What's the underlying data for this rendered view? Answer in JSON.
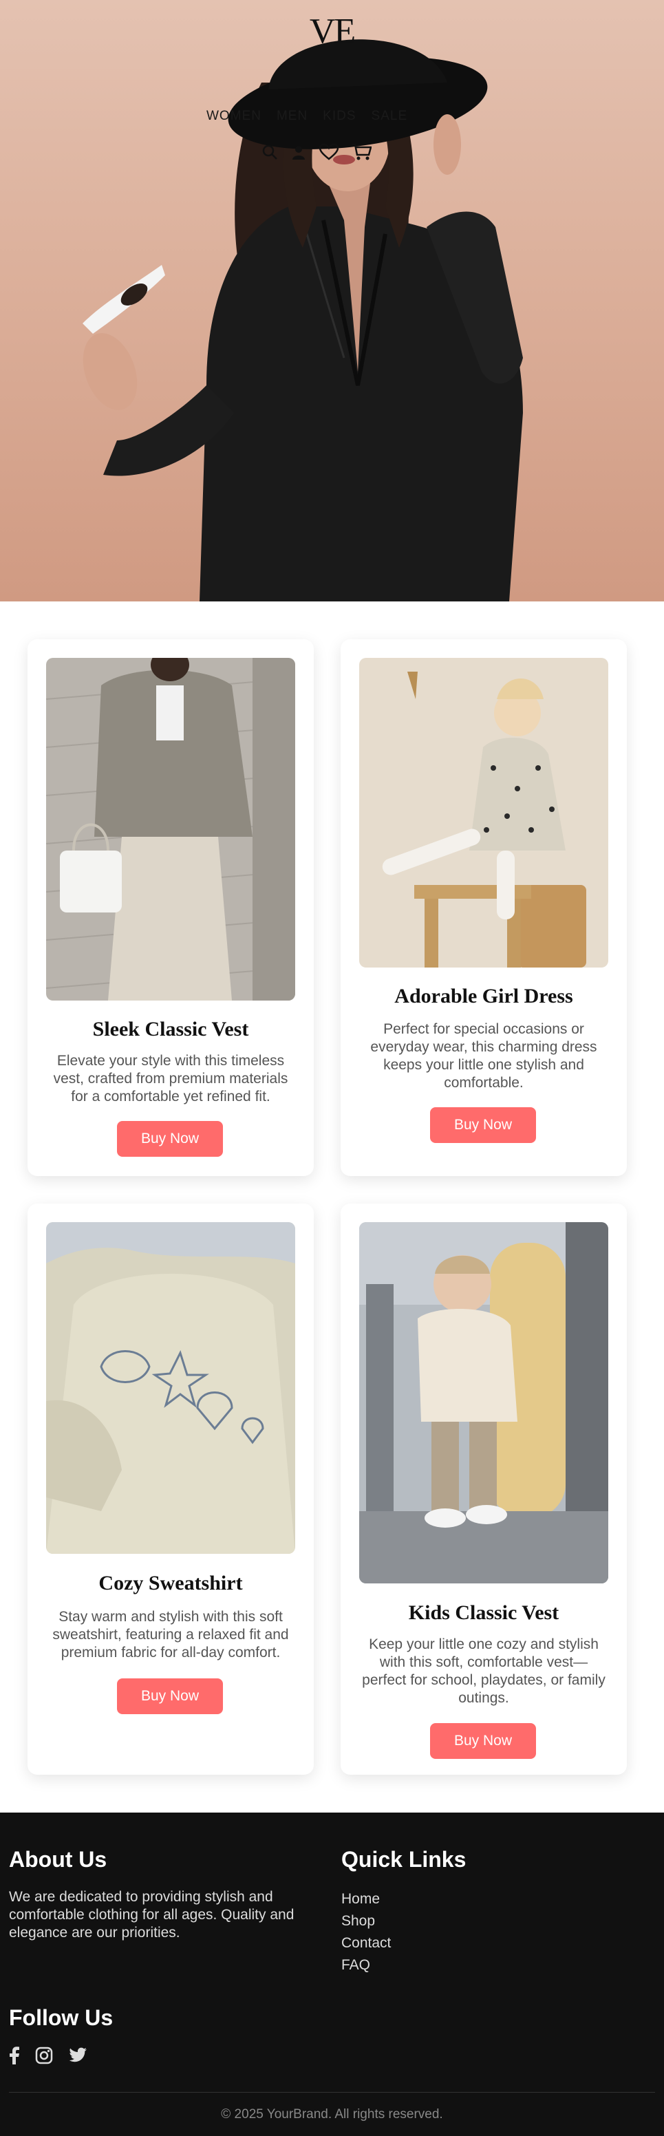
{
  "brand": {
    "logo": "VE"
  },
  "nav": {
    "items": [
      "WOMEN",
      "MEN",
      "KIDS",
      "SALE"
    ]
  },
  "hero": {
    "icons": [
      "search-icon",
      "user-icon",
      "heart-icon",
      "cart-icon"
    ]
  },
  "products": [
    {
      "title": "Sleek Classic Vest",
      "description": "Elevate your style with this timeless vest, crafted from premium materials for a comfortable yet refined fit.",
      "button": "Buy Now"
    },
    {
      "title": "Adorable Girl Dress",
      "description": "Perfect for special occasions or everyday wear, this charming dress keeps your little one stylish and comfortable.",
      "button": "Buy Now"
    },
    {
      "title": "Cozy Sweatshirt",
      "description": "Stay warm and stylish with this soft sweatshirt, featuring a relaxed fit and premium fabric for all-day comfort.",
      "button": "Buy Now"
    },
    {
      "title": "Kids Classic Vest",
      "description": "Keep your little one cozy and stylish with this soft, comfortable vest—perfect for school, playdates, or family outings.",
      "button": "Buy Now"
    }
  ],
  "footer": {
    "about_title": "About Us",
    "about_text": "We are dedicated to providing stylish and comfortable clothing for all ages. Quality and elegance are our priorities.",
    "links_title": "Quick Links",
    "links": [
      "Home",
      "Shop",
      "Contact",
      "FAQ"
    ],
    "follow_title": "Follow Us",
    "social": [
      "facebook-icon",
      "instagram-icon",
      "twitter-icon"
    ],
    "copyright": "© 2025 YourBrand. All rights reserved."
  },
  "colors": {
    "accent": "#ff6b6b",
    "footer_bg": "#111111",
    "hero_bg": "#dcb09b"
  }
}
